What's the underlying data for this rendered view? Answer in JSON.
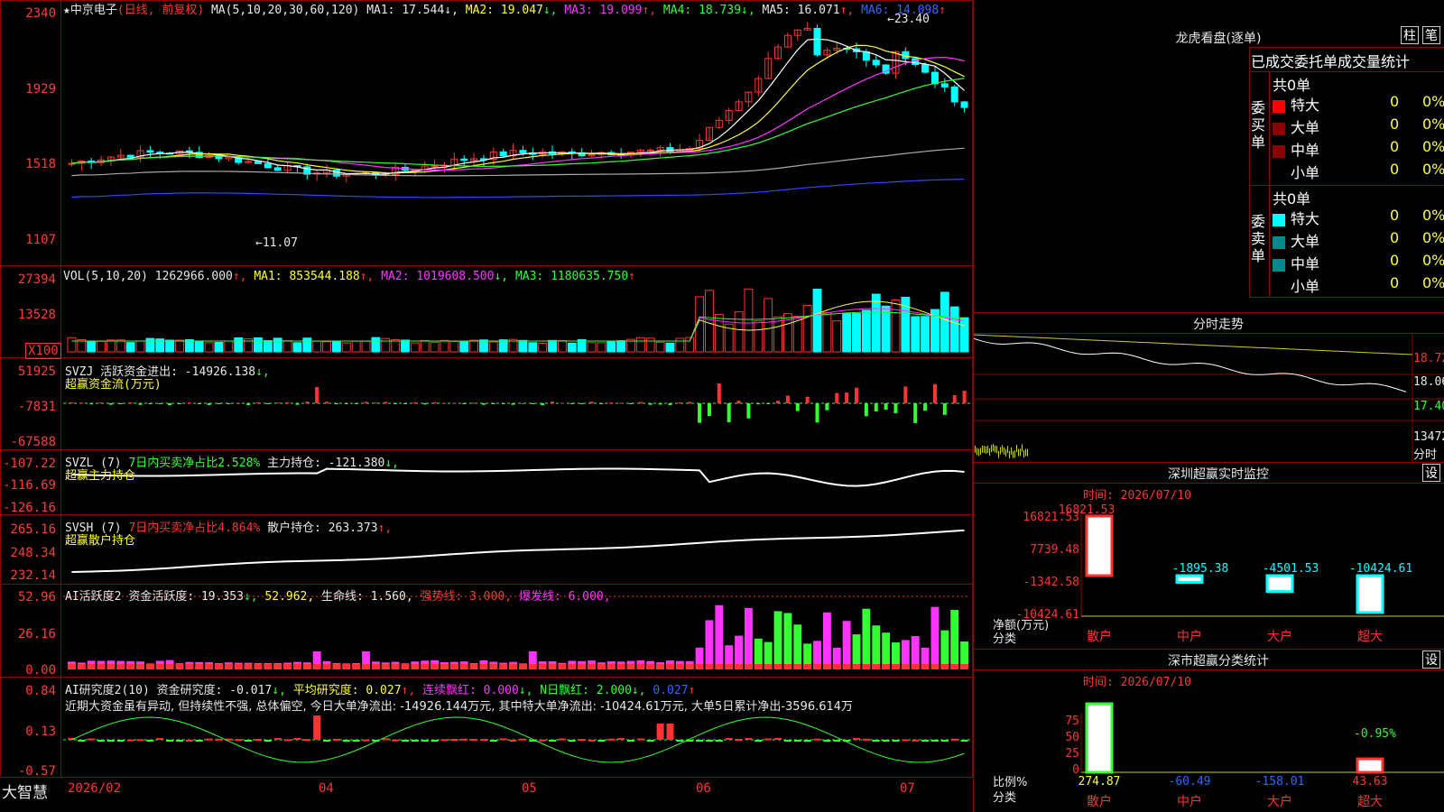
{
  "stock": {
    "star": "★",
    "name": "中京电子",
    "period": "(日线, 前复权)"
  },
  "main_axis": [
    "2340",
    "1929",
    "1518",
    "1107"
  ],
  "main_header": {
    "ma": "MA(5,10,20,30,60,120)",
    "ma1": "MA1: 17.544",
    "ma1_arrow": "↓,",
    "ma2": "MA2: 19.047",
    "ma2_arrow": "↓,",
    "ma3": "MA3: 19.099",
    "ma3_arrow": "↑,",
    "ma4": "MA4: 18.739",
    "ma4_arrow": "↓,",
    "ma5": "MA5: 16.071",
    "ma5_arrow": "↑,",
    "ma6": "MA6: 14.098",
    "ma6_arrow": "↑"
  },
  "main_annot": {
    "high": "←23.40",
    "low": "←11.07"
  },
  "vol": {
    "axis": [
      "27394",
      "13528",
      "X100"
    ],
    "label": "VOL(5,10,20)",
    "value": "1262966.000",
    "arrow": "↑,",
    "ma1": "MA1: 853544.188",
    "ma1_arrow": "↑,",
    "ma2": "MA2: 1019608.500",
    "ma2_arrow": "↓,",
    "ma3": "MA3: 1180635.750",
    "ma3_arrow": "↑"
  },
  "svzj": {
    "axis": [
      "51925",
      "-7831",
      "-67588"
    ],
    "label": "SVZJ",
    "text": "活跃资金进出: -14926.138",
    "arrow": "↓,",
    "sub": "超赢资金流(万元)"
  },
  "svzl": {
    "axis": [
      "-107.22",
      "-116.69",
      "-126.16"
    ],
    "label": "SVZL (7)",
    "ratio": "7日内买卖净占比2.528%",
    "hold": "主力持仓: -121.380",
    "arrow": "↓,",
    "sub": "超赢主力持仓"
  },
  "svsh": {
    "axis": [
      "265.16",
      "248.34",
      "232.14"
    ],
    "label": "SVSH (7)",
    "ratio": "7日内买卖净占比4.864%",
    "hold": "散户持仓: 263.373",
    "arrow": "↑,",
    "sub": "超赢散户持仓"
  },
  "ai1": {
    "axis": [
      "52.96",
      "26.16",
      "0.00"
    ],
    "label": "AI活跃度2",
    "act": "资金活跃度: 19.353",
    "act_arrow": "↓,",
    "v2": "52.962,",
    "life": "生命线: 1.560,",
    "strong": "强势线: 3.000,",
    "burst": "爆发线: 6.000,"
  },
  "ai2": {
    "axis": [
      "0.84",
      "0.13",
      "-0.57"
    ],
    "label": "AI研究度2(10)",
    "res": "资金研究度: -0.017",
    "res_arrow": "↓,",
    "avg": "平均研究度: 0.027",
    "avg_arrow": "↑,",
    "red": "连续飘红: 0.000",
    "red_arrow": "↓,",
    "nred": "N日飘红: 2.000",
    "nred_arrow": "↓,",
    "last": "0.027",
    "last_arrow": "↑",
    "comment": "近期大资金虽有异动, 但持续性不强, 总体偏空, 今日大单净流出: -14926.144万元, 其中特大单净流出: -10424.61万元, 大单5日累计净出-3596.614万"
  },
  "xaxis": {
    "brand": "大智慧",
    "dates": [
      "2026/02",
      "04",
      "05",
      "06",
      "07"
    ]
  },
  "longhu": {
    "title": "龙虎看盘(逐单)",
    "btn1": "柱",
    "btn2": "笔",
    "header": "已成交委托单成交量统计",
    "buy_side": "委买单",
    "sell_side": "委卖单",
    "buy_total": "共0单",
    "sell_total": "共0单",
    "rows": [
      {
        "name": "特大",
        "v": "0",
        "p": "0%",
        "color": "#ff0000"
      },
      {
        "name": "大单",
        "v": "0",
        "p": "0%",
        "color": "#8b0000"
      },
      {
        "name": "中单",
        "v": "0",
        "p": "0%",
        "color": "#8b0000"
      },
      {
        "name": "小单",
        "v": "0",
        "p": "0%",
        "color": ""
      }
    ],
    "srows": [
      {
        "name": "特大",
        "v": "0",
        "p": "0%",
        "color": "#00ffff"
      },
      {
        "name": "大单",
        "v": "0",
        "p": "0%",
        "color": "#008b8b"
      },
      {
        "name": "中单",
        "v": "0",
        "p": "0%",
        "color": "#008b8b"
      },
      {
        "name": "小单",
        "v": "0",
        "p": "0%",
        "color": ""
      }
    ]
  },
  "intraday": {
    "title": "分时走势",
    "axis": [
      "18.72",
      "18.06",
      "17.40",
      "13472"
    ],
    "unit": "分时"
  },
  "monitor": {
    "title": "深圳超赢实时监控",
    "btn": "设",
    "time": "时间: 2026/07/10",
    "axis": [
      "16821.53",
      "7739.48",
      "-1342.58",
      "-10424.61"
    ],
    "unit": "净额(万元)",
    "cat_label": "分类",
    "chart_data": {
      "type": "bar",
      "categories": [
        "散户",
        "中户",
        "大户",
        "超大"
      ],
      "values": [
        16821.53,
        -1895.38,
        -4501.53,
        -10424.61
      ],
      "labels": [
        "16821.53",
        "-1895.38",
        "-4501.53",
        "-10424.61"
      ],
      "ylim": [
        -10424.61,
        16821.53
      ]
    }
  },
  "classify": {
    "title": "深市超赢分类统计",
    "btn": "设",
    "time": "时间: 2026/07/10",
    "axis": [
      "75",
      "50",
      "25",
      "0"
    ],
    "unit": "比例%",
    "cat_label": "分类",
    "top_label": "-0.95%",
    "chart_data": {
      "type": "bar",
      "categories": [
        "散户",
        "中户",
        "大户",
        "超大"
      ],
      "values": [
        274.87,
        -60.49,
        -158.01,
        43.63
      ],
      "labels": [
        "274.87",
        "-60.49",
        "-158.01",
        "43.63"
      ],
      "ylim": [
        0,
        75
      ]
    }
  },
  "colors": {
    "up": "#ff3333",
    "down": "#00ffff",
    "border": "#8b0000",
    "grid": "#8b0000"
  }
}
